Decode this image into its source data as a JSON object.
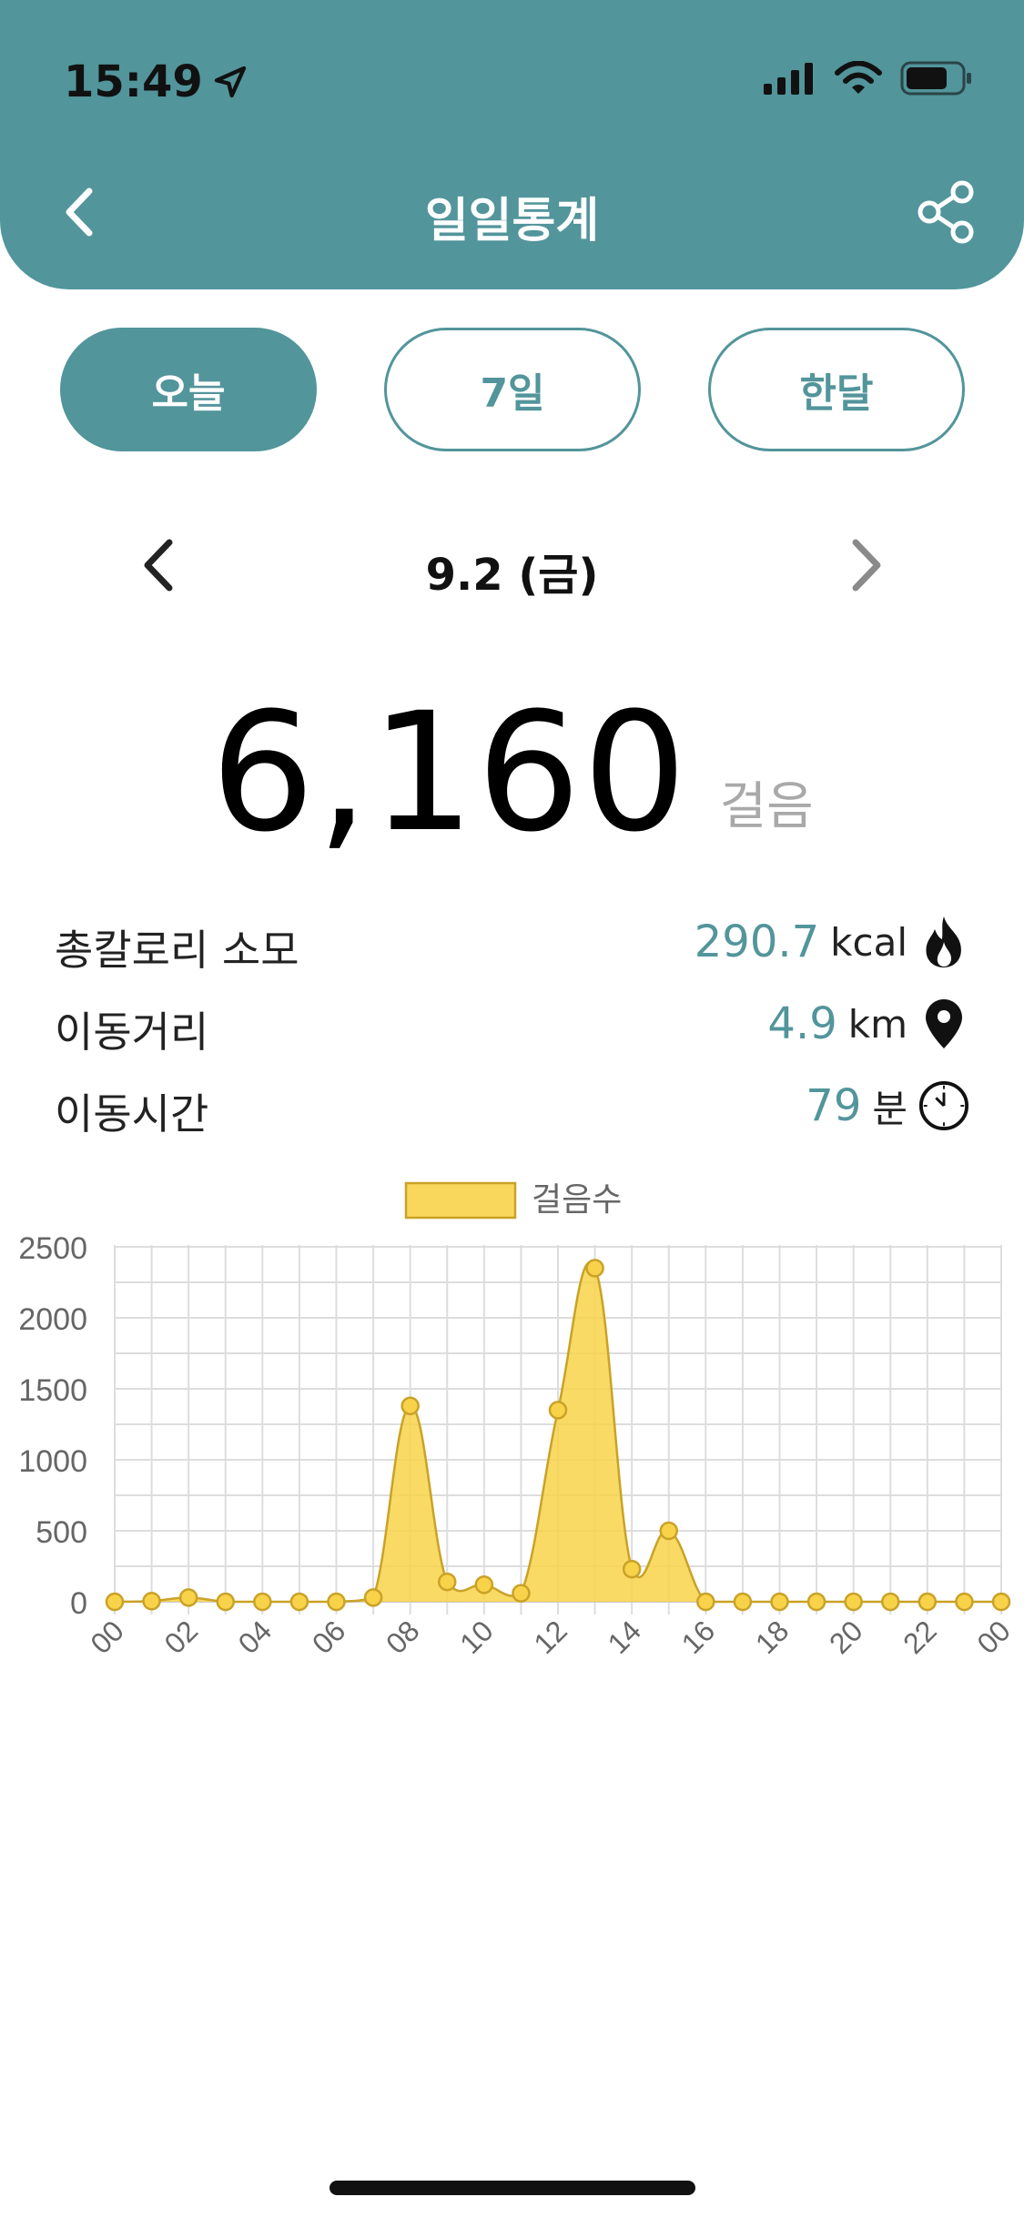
{
  "status_bar": {
    "time": "15:49",
    "icons": [
      "location-arrow-icon",
      "signal-icon",
      "wifi-icon",
      "battery-icon"
    ]
  },
  "header": {
    "title": "일일통계",
    "back_icon": "chevron-left-icon",
    "share_icon": "share-icon",
    "background_color": "#52959b"
  },
  "tabs": [
    {
      "label": "오늘",
      "active": true
    },
    {
      "label": "7일",
      "active": false
    },
    {
      "label": "한달",
      "active": false
    }
  ],
  "date_nav": {
    "label": "9.2 (금)",
    "prev_icon": "chevron-left-icon",
    "next_icon": "chevron-right-icon"
  },
  "steps": {
    "value": "6,160",
    "unit": "걸음"
  },
  "stats": [
    {
      "label": "총칼로리 소모",
      "value": "290.7",
      "unit": "kcal",
      "icon": "fire-icon"
    },
    {
      "label": "이동거리",
      "value": "4.9",
      "unit": "km",
      "icon": "location-pin-icon"
    },
    {
      "label": "이동시간",
      "value": "79",
      "unit": "분",
      "icon": "clock-icon"
    }
  ],
  "chart_data": {
    "type": "area",
    "legend": [
      "걸음수"
    ],
    "legend_position": "top-center",
    "grid": true,
    "ylim": [
      0,
      2500
    ],
    "y_ticks": [
      "0",
      "500",
      "1000",
      "1500",
      "2000",
      "2500"
    ],
    "x_tick_labels": [
      "00",
      "02",
      "04",
      "06",
      "08",
      "10",
      "12",
      "14",
      "16",
      "18",
      "20",
      "22",
      "00"
    ],
    "x": [
      0,
      1,
      2,
      3,
      4,
      5,
      6,
      7,
      8,
      9,
      10,
      11,
      12,
      13,
      14,
      15,
      16,
      17,
      18,
      19,
      20,
      21,
      22,
      23,
      24
    ],
    "series": [
      {
        "name": "걸음수",
        "color": "#f8d34a",
        "values": [
          0,
          5,
          30,
          0,
          0,
          0,
          0,
          30,
          1380,
          140,
          120,
          60,
          1350,
          2350,
          230,
          500,
          0,
          0,
          0,
          0,
          0,
          0,
          0,
          0,
          0
        ]
      }
    ]
  }
}
